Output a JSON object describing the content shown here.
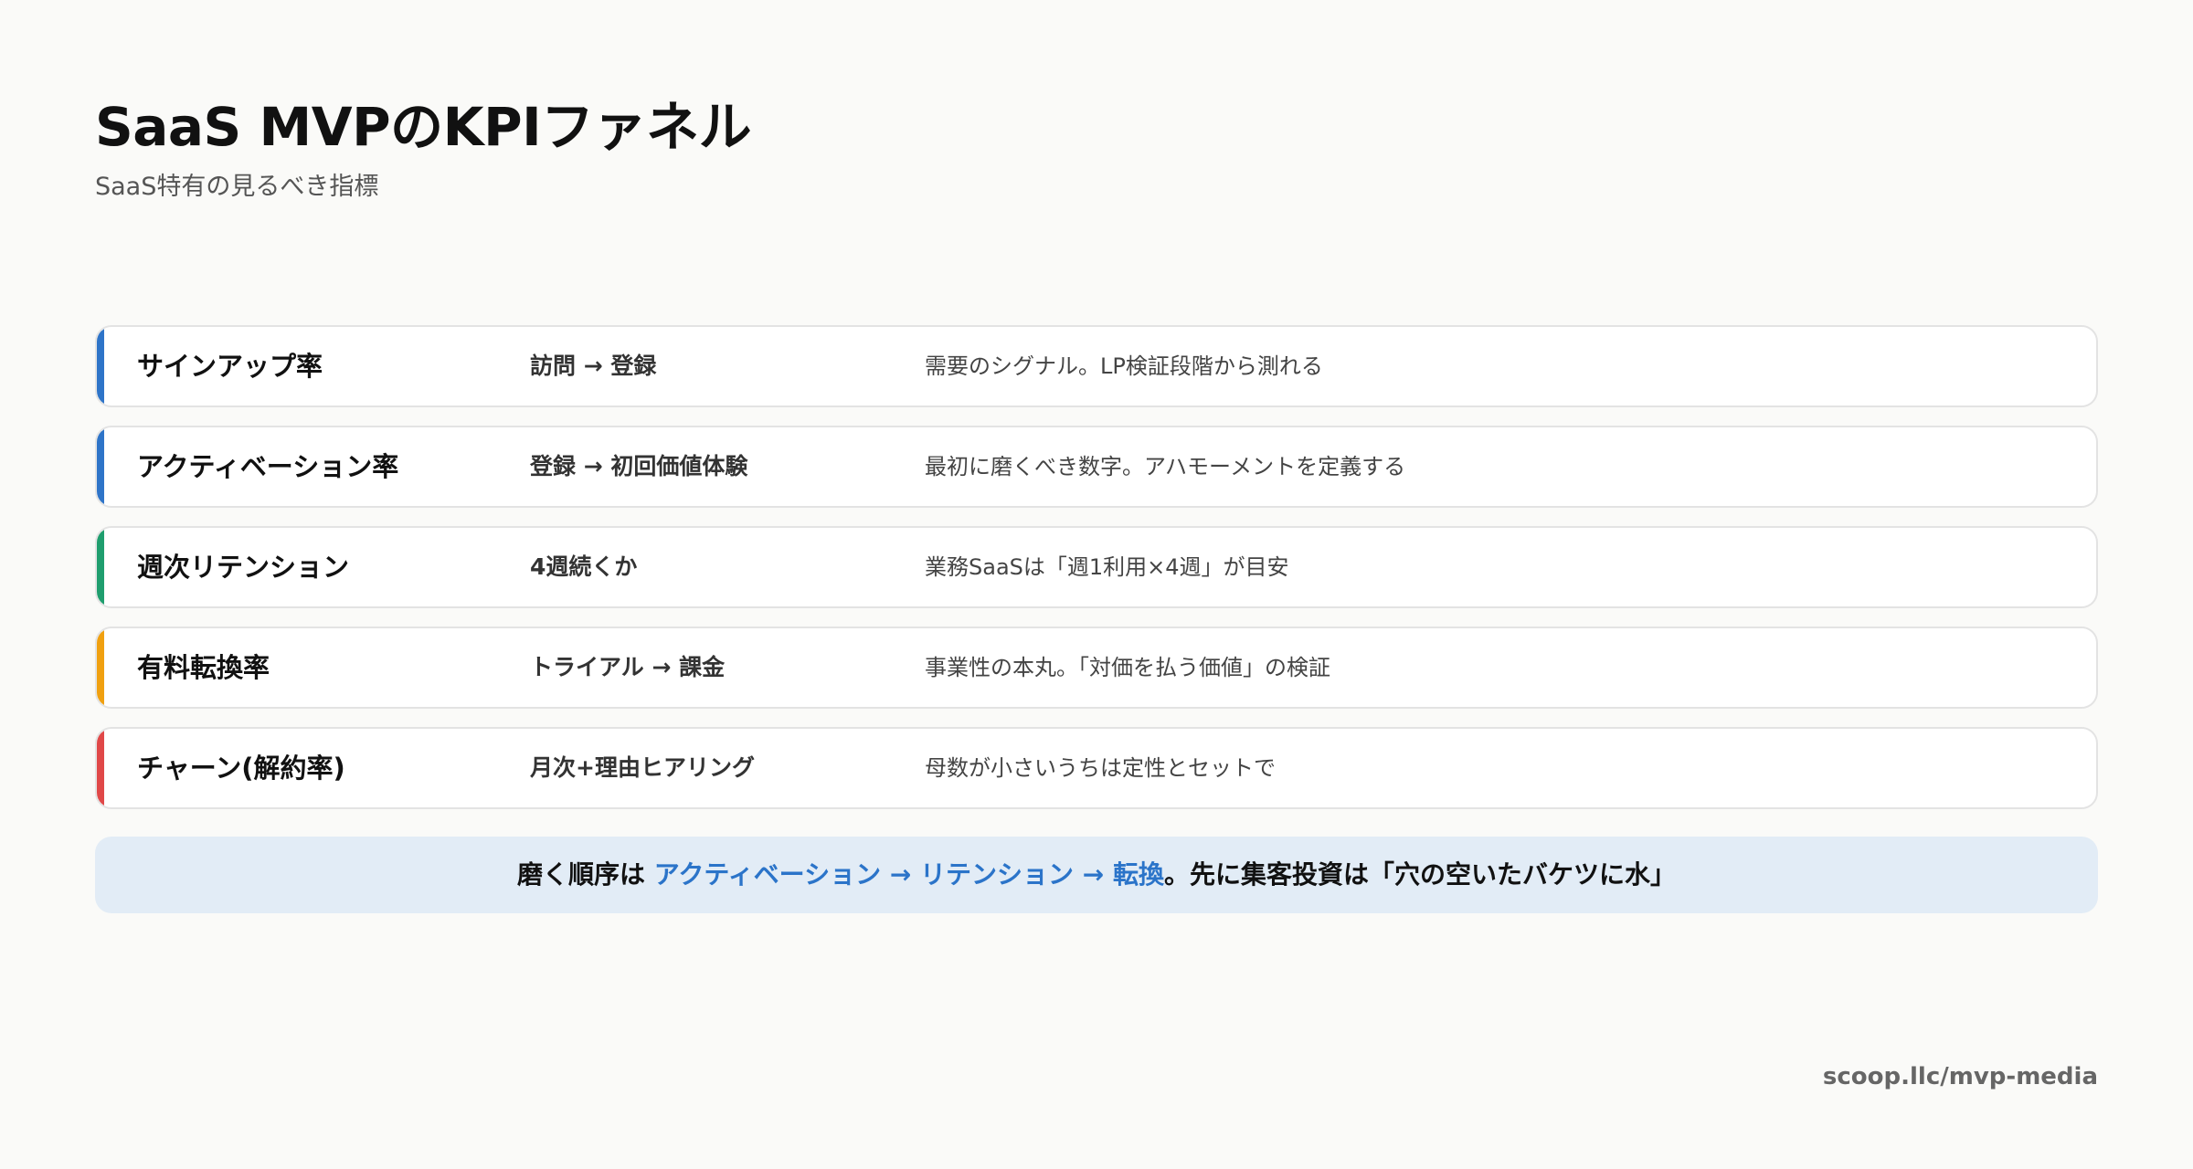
{
  "header": {
    "title": "SaaS MVPのKPIファネル",
    "subtitle": "SaaS特有の見るべき指標"
  },
  "rows": [
    {
      "name": "サインアップ率",
      "flow": "訪問 → 登録",
      "note": "需要のシグナル。LP検証段階から測れる",
      "accent": "#2e74c8"
    },
    {
      "name": "アクティベーション率",
      "flow": "登録 → 初回価値体験",
      "note": "最初に磨くべき数字。アハモーメントを定義する",
      "accent": "#2e74c8"
    },
    {
      "name": "週次リテンション",
      "flow": "4週続くか",
      "note": "業務SaaSは「週1利用×4週」が目安",
      "accent": "#1f9e6e"
    },
    {
      "name": "有料転換率",
      "flow": "トライアル → 課金",
      "note": "事業性の本丸。「対価を払う価値」の検証",
      "accent": "#f0a010"
    },
    {
      "name": "チャーン(解約率)",
      "flow": "月次+理由ヒアリング",
      "note": "母数が小さいうちは定性とセットで",
      "accent": "#e04848"
    }
  ],
  "callout": {
    "prefix": "磨く順序は ",
    "highlight": "アクティベーション → リテンション → 転換",
    "suffix": "。先に集客投資は「穴の空いたバケツに水」"
  },
  "footer": {
    "url": "scoop.llc/mvp-media"
  }
}
